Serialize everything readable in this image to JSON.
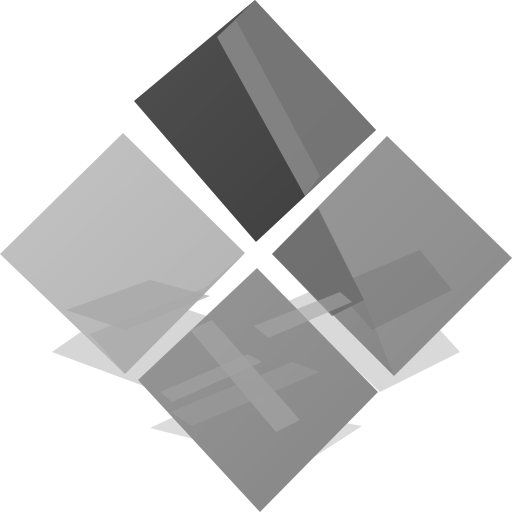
{
  "image": {
    "kind": "logo",
    "description_tags": [
      "four-diamond-tiles",
      "grayscale",
      "glossy",
      "reflection"
    ]
  },
  "colors": {
    "background": "#ffffff",
    "tile_top": "#454545",
    "tile_left": "#bdbdbd",
    "tile_right": "#8c8c8c",
    "tile_bottom": "#8f8f8f",
    "shadow": "#cfcfcf",
    "highlight": "#ffffff"
  }
}
